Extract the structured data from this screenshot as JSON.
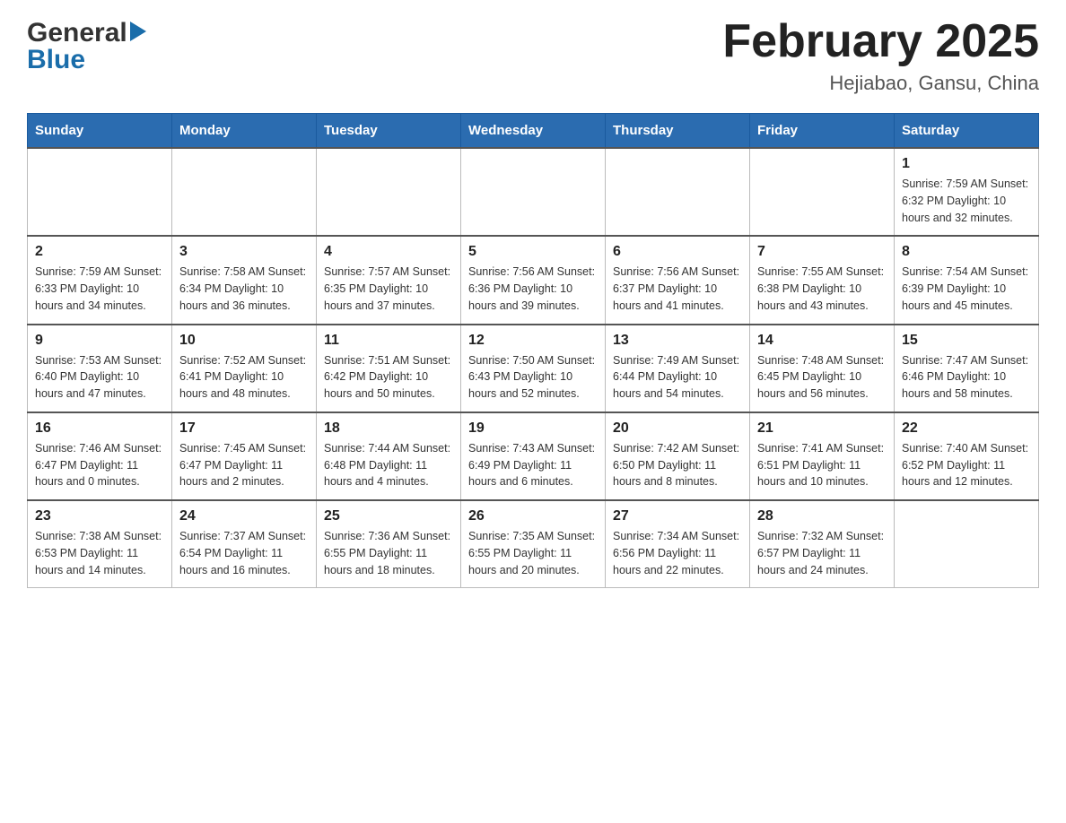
{
  "header": {
    "logo": {
      "general": "General",
      "blue": "Blue"
    },
    "title": "February 2025",
    "location": "Hejiabao, Gansu, China"
  },
  "calendar": {
    "days_of_week": [
      "Sunday",
      "Monday",
      "Tuesday",
      "Wednesday",
      "Thursday",
      "Friday",
      "Saturday"
    ],
    "weeks": [
      {
        "days": [
          {
            "number": "",
            "info": ""
          },
          {
            "number": "",
            "info": ""
          },
          {
            "number": "",
            "info": ""
          },
          {
            "number": "",
            "info": ""
          },
          {
            "number": "",
            "info": ""
          },
          {
            "number": "",
            "info": ""
          },
          {
            "number": "1",
            "info": "Sunrise: 7:59 AM\nSunset: 6:32 PM\nDaylight: 10 hours and 32 minutes."
          }
        ]
      },
      {
        "days": [
          {
            "number": "2",
            "info": "Sunrise: 7:59 AM\nSunset: 6:33 PM\nDaylight: 10 hours and 34 minutes."
          },
          {
            "number": "3",
            "info": "Sunrise: 7:58 AM\nSunset: 6:34 PM\nDaylight: 10 hours and 36 minutes."
          },
          {
            "number": "4",
            "info": "Sunrise: 7:57 AM\nSunset: 6:35 PM\nDaylight: 10 hours and 37 minutes."
          },
          {
            "number": "5",
            "info": "Sunrise: 7:56 AM\nSunset: 6:36 PM\nDaylight: 10 hours and 39 minutes."
          },
          {
            "number": "6",
            "info": "Sunrise: 7:56 AM\nSunset: 6:37 PM\nDaylight: 10 hours and 41 minutes."
          },
          {
            "number": "7",
            "info": "Sunrise: 7:55 AM\nSunset: 6:38 PM\nDaylight: 10 hours and 43 minutes."
          },
          {
            "number": "8",
            "info": "Sunrise: 7:54 AM\nSunset: 6:39 PM\nDaylight: 10 hours and 45 minutes."
          }
        ]
      },
      {
        "days": [
          {
            "number": "9",
            "info": "Sunrise: 7:53 AM\nSunset: 6:40 PM\nDaylight: 10 hours and 47 minutes."
          },
          {
            "number": "10",
            "info": "Sunrise: 7:52 AM\nSunset: 6:41 PM\nDaylight: 10 hours and 48 minutes."
          },
          {
            "number": "11",
            "info": "Sunrise: 7:51 AM\nSunset: 6:42 PM\nDaylight: 10 hours and 50 minutes."
          },
          {
            "number": "12",
            "info": "Sunrise: 7:50 AM\nSunset: 6:43 PM\nDaylight: 10 hours and 52 minutes."
          },
          {
            "number": "13",
            "info": "Sunrise: 7:49 AM\nSunset: 6:44 PM\nDaylight: 10 hours and 54 minutes."
          },
          {
            "number": "14",
            "info": "Sunrise: 7:48 AM\nSunset: 6:45 PM\nDaylight: 10 hours and 56 minutes."
          },
          {
            "number": "15",
            "info": "Sunrise: 7:47 AM\nSunset: 6:46 PM\nDaylight: 10 hours and 58 minutes."
          }
        ]
      },
      {
        "days": [
          {
            "number": "16",
            "info": "Sunrise: 7:46 AM\nSunset: 6:47 PM\nDaylight: 11 hours and 0 minutes."
          },
          {
            "number": "17",
            "info": "Sunrise: 7:45 AM\nSunset: 6:47 PM\nDaylight: 11 hours and 2 minutes."
          },
          {
            "number": "18",
            "info": "Sunrise: 7:44 AM\nSunset: 6:48 PM\nDaylight: 11 hours and 4 minutes."
          },
          {
            "number": "19",
            "info": "Sunrise: 7:43 AM\nSunset: 6:49 PM\nDaylight: 11 hours and 6 minutes."
          },
          {
            "number": "20",
            "info": "Sunrise: 7:42 AM\nSunset: 6:50 PM\nDaylight: 11 hours and 8 minutes."
          },
          {
            "number": "21",
            "info": "Sunrise: 7:41 AM\nSunset: 6:51 PM\nDaylight: 11 hours and 10 minutes."
          },
          {
            "number": "22",
            "info": "Sunrise: 7:40 AM\nSunset: 6:52 PM\nDaylight: 11 hours and 12 minutes."
          }
        ]
      },
      {
        "days": [
          {
            "number": "23",
            "info": "Sunrise: 7:38 AM\nSunset: 6:53 PM\nDaylight: 11 hours and 14 minutes."
          },
          {
            "number": "24",
            "info": "Sunrise: 7:37 AM\nSunset: 6:54 PM\nDaylight: 11 hours and 16 minutes."
          },
          {
            "number": "25",
            "info": "Sunrise: 7:36 AM\nSunset: 6:55 PM\nDaylight: 11 hours and 18 minutes."
          },
          {
            "number": "26",
            "info": "Sunrise: 7:35 AM\nSunset: 6:55 PM\nDaylight: 11 hours and 20 minutes."
          },
          {
            "number": "27",
            "info": "Sunrise: 7:34 AM\nSunset: 6:56 PM\nDaylight: 11 hours and 22 minutes."
          },
          {
            "number": "28",
            "info": "Sunrise: 7:32 AM\nSunset: 6:57 PM\nDaylight: 11 hours and 24 minutes."
          },
          {
            "number": "",
            "info": ""
          }
        ]
      }
    ]
  }
}
